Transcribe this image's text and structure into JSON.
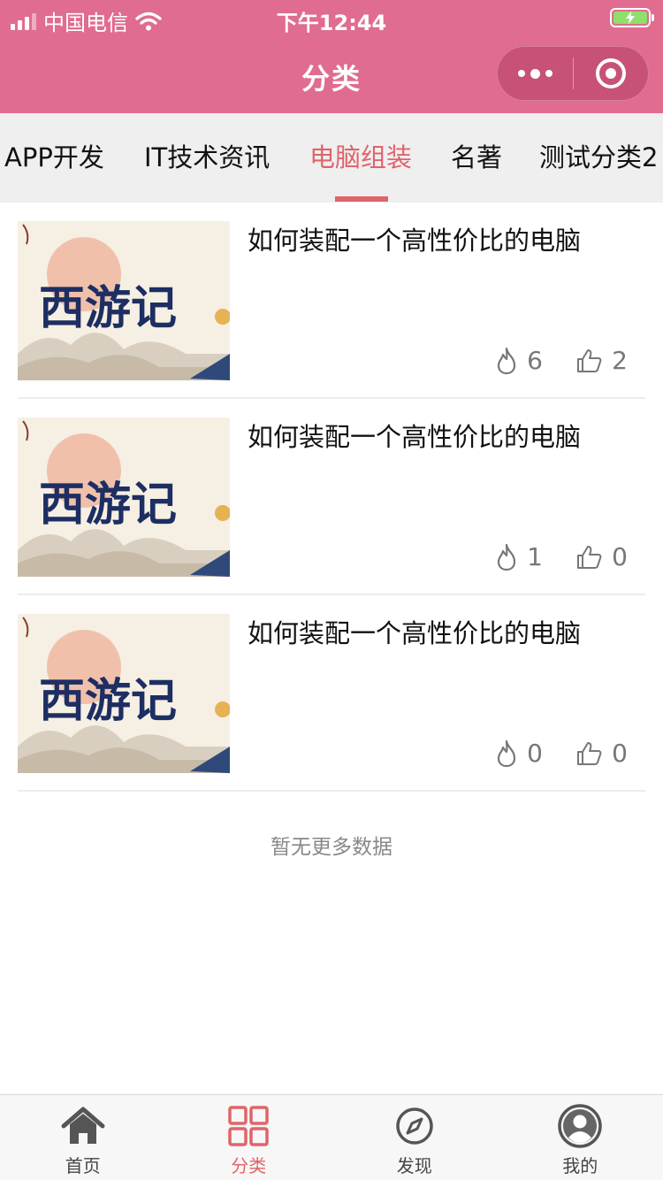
{
  "status_bar": {
    "carrier": "中国电信",
    "time": "下午12:44"
  },
  "nav": {
    "title": "分类"
  },
  "category_tabs": [
    {
      "label": "APP开发",
      "active": false
    },
    {
      "label": "IT技术资讯",
      "active": false
    },
    {
      "label": "电脑组装",
      "active": true
    },
    {
      "label": "名著",
      "active": false
    },
    {
      "label": "测试分类2",
      "active": false
    }
  ],
  "articles": [
    {
      "title": "如何装配一个高性价比的电脑",
      "thumb_text": "西游记",
      "views": "6",
      "likes": "2"
    },
    {
      "title": "如何装配一个高性价比的电脑",
      "thumb_text": "西游记",
      "views": "1",
      "likes": "0"
    },
    {
      "title": "如何装配一个高性价比的电脑",
      "thumb_text": "西游记",
      "views": "0",
      "likes": "0"
    }
  ],
  "empty_hint": "暂无更多数据",
  "tab_bar": [
    {
      "label": "首页",
      "icon": "home-icon",
      "active": false
    },
    {
      "label": "分类",
      "icon": "grid-icon",
      "active": true
    },
    {
      "label": "发现",
      "icon": "compass-icon",
      "active": false
    },
    {
      "label": "我的",
      "icon": "user-icon",
      "active": false
    }
  ],
  "colors": {
    "brand": "#e06c8f",
    "accent": "#e0646a",
    "battery": "#8ee06a"
  }
}
